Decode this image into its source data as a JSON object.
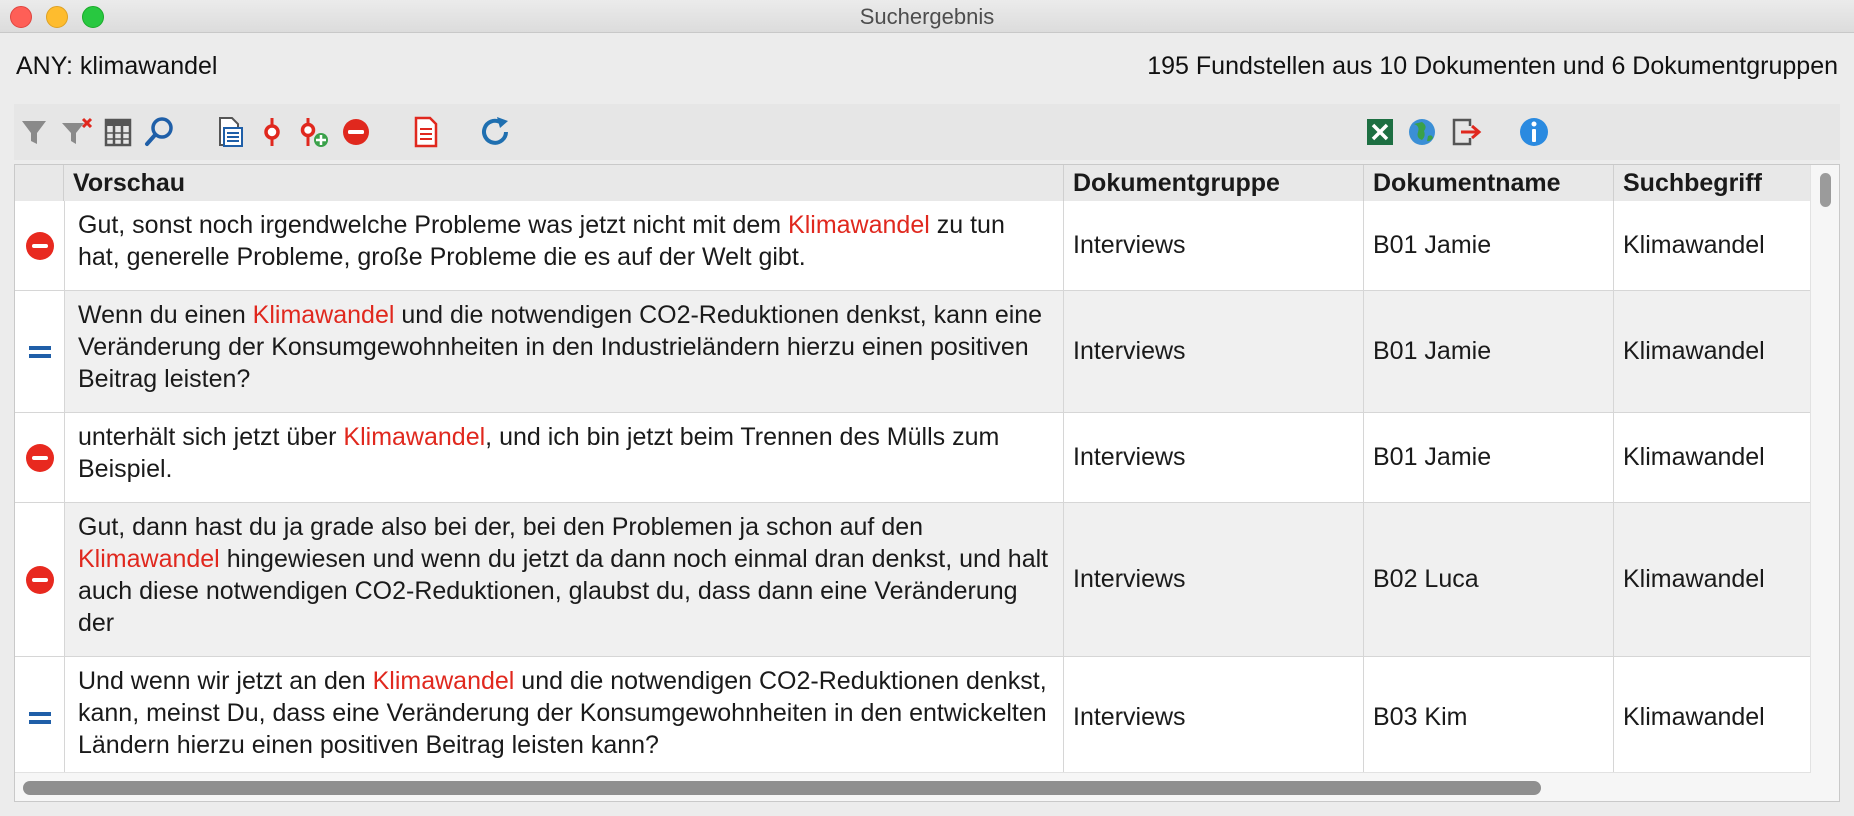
{
  "window": {
    "title": "Suchergebnis"
  },
  "header": {
    "query": "ANY: klimawandel",
    "summary": "195 Fundstellen aus 10 Dokumenten und 6 Dokumentgruppen"
  },
  "toolbar": {
    "left_icons": [
      "filter-icon",
      "clear-filter-icon",
      "columns-icon",
      "search-icon",
      "document-list-icon",
      "code-pin-icon",
      "add-code-icon",
      "remove-icon",
      "export-report-icon",
      "refresh-icon"
    ],
    "right_icons": [
      "excel-export-icon",
      "web-export-icon",
      "exit-export-icon",
      "info-icon"
    ],
    "colors": {
      "red": "#e0281e",
      "blue": "#1f5fa8",
      "gray": "#8a8a8a",
      "green": "#1d6f42"
    }
  },
  "table": {
    "columns": [
      "Vorschau",
      "Dokumentgruppe",
      "Dokumentname",
      "Suchbegriff"
    ],
    "rows": [
      {
        "status": "minus",
        "pre": "Gut, sonst noch irgendwelche Probleme was jetzt nicht mit dem ",
        "hit": "Klimawandel",
        "post": " zu tun hat, generelle Probleme, große Probleme die es auf der Welt gibt.",
        "group": "Interviews",
        "document": "B01 Jamie",
        "term": "Klimawandel"
      },
      {
        "status": "equal",
        "pre": "Wenn du einen ",
        "hit": "Klimawandel",
        "post": " und die notwendigen CO2-Reduktionen denkst, kann eine Veränderung der Konsumgewohnheiten in den Industrieländern hierzu einen positiven Beitrag leisten?",
        "group": "Interviews",
        "document": "B01 Jamie",
        "term": "Klimawandel"
      },
      {
        "status": "minus",
        "pre": "unterhält sich jetzt über ",
        "hit": "Klimawandel",
        "post": ", und ich bin jetzt beim Trennen des Mülls zum Beispiel.",
        "group": "Interviews",
        "document": "B01 Jamie",
        "term": "Klimawandel"
      },
      {
        "status": "minus",
        "pre": "Gut, dann hast du ja grade also bei der, bei den Problemen ja schon auf den ",
        "hit": "Klimawandel",
        "post": " hingewiesen und wenn du jetzt da dann noch einmal dran denkst, und halt auch diese notwendigen CO2-Reduktionen, glaubst du, dass dann eine Veränderung der",
        "group": "Interviews",
        "document": "B02 Luca",
        "term": "Klimawandel"
      },
      {
        "status": "equal",
        "pre": "Und wenn wir jetzt an den ",
        "hit": "Klimawandel",
        "post": " und die notwendigen CO2-Reduktionen denkst, kann, meinst Du, dass eine Veränderung der Konsumgewohnheiten in den entwickelten Ländern hierzu einen positiven Beitrag leisten kann?",
        "group": "Interviews",
        "document": "B03 Kim",
        "term": "Klimawandel"
      }
    ]
  }
}
